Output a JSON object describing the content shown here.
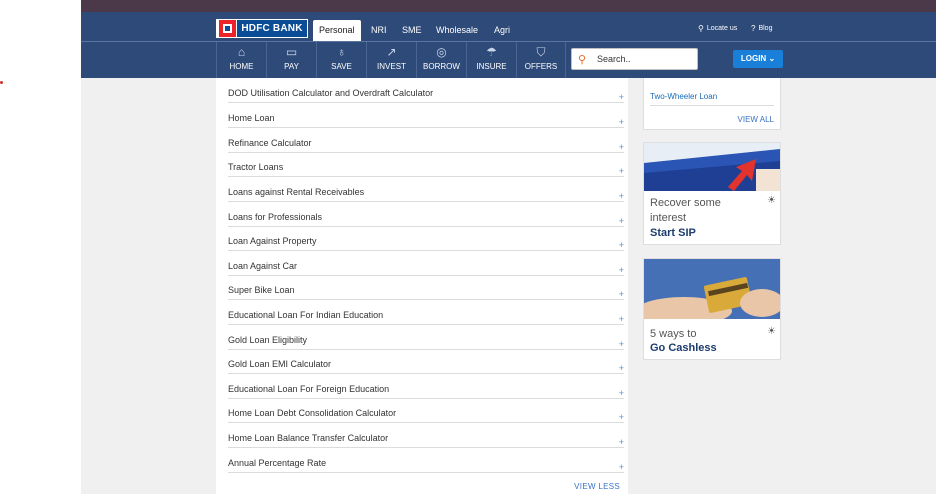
{
  "header": {
    "brand": "HDFC BANK",
    "segments": [
      "Personal",
      "NRI",
      "SME",
      "Wholesale",
      "Agri"
    ],
    "locate": "Locate us",
    "blog": "Blog"
  },
  "nav": {
    "items": [
      {
        "label": "HOME",
        "icon": "home-icon"
      },
      {
        "label": "PAY",
        "icon": "pay-icon"
      },
      {
        "label": "SAVE",
        "icon": "save-icon"
      },
      {
        "label": "INVEST",
        "icon": "invest-icon"
      },
      {
        "label": "BORROW",
        "icon": "borrow-icon"
      },
      {
        "label": "INSURE",
        "icon": "insure-icon"
      },
      {
        "label": "OFFERS",
        "icon": "offers-icon"
      }
    ],
    "search_placeholder": "Search..",
    "login": "LOGIN"
  },
  "calculators": {
    "items": [
      "DOD Utilisation Calculator and Overdraft Calculator",
      "Home Loan",
      "Refinance Calculator",
      "Tractor Loans",
      "Loans against Rental Receivables",
      "Loans for Professionals",
      "Loan Against Property",
      "Loan Against Car",
      "Super Bike Loan",
      "Educational Loan For Indian Education",
      "Gold Loan Eligibility",
      "Gold Loan EMI Calculator",
      "Educational Loan For Foreign Education",
      "Home Loan Debt Consolidation Calculator",
      "Home Loan Balance Transfer Calculator",
      "Annual Percentage Rate"
    ],
    "expand_symbol": "+",
    "view_less": "VIEW LESS"
  },
  "sidebar": {
    "loan_link": "Two-Wheeler Loan",
    "view_all": "VIEW ALL",
    "promos": [
      {
        "line1": "Recover some",
        "line2": "interest",
        "line3": "Start SIP"
      },
      {
        "line1": "5 ways to",
        "line2": "Go Cashless"
      }
    ]
  },
  "colors": {
    "header_bg": "#2e4a78",
    "top_strip": "#4b3848",
    "login_bg": "#1a7fd8",
    "link": "#3a72c6",
    "brand_red": "#ed232a",
    "brand_blue": "#0a4c95"
  }
}
